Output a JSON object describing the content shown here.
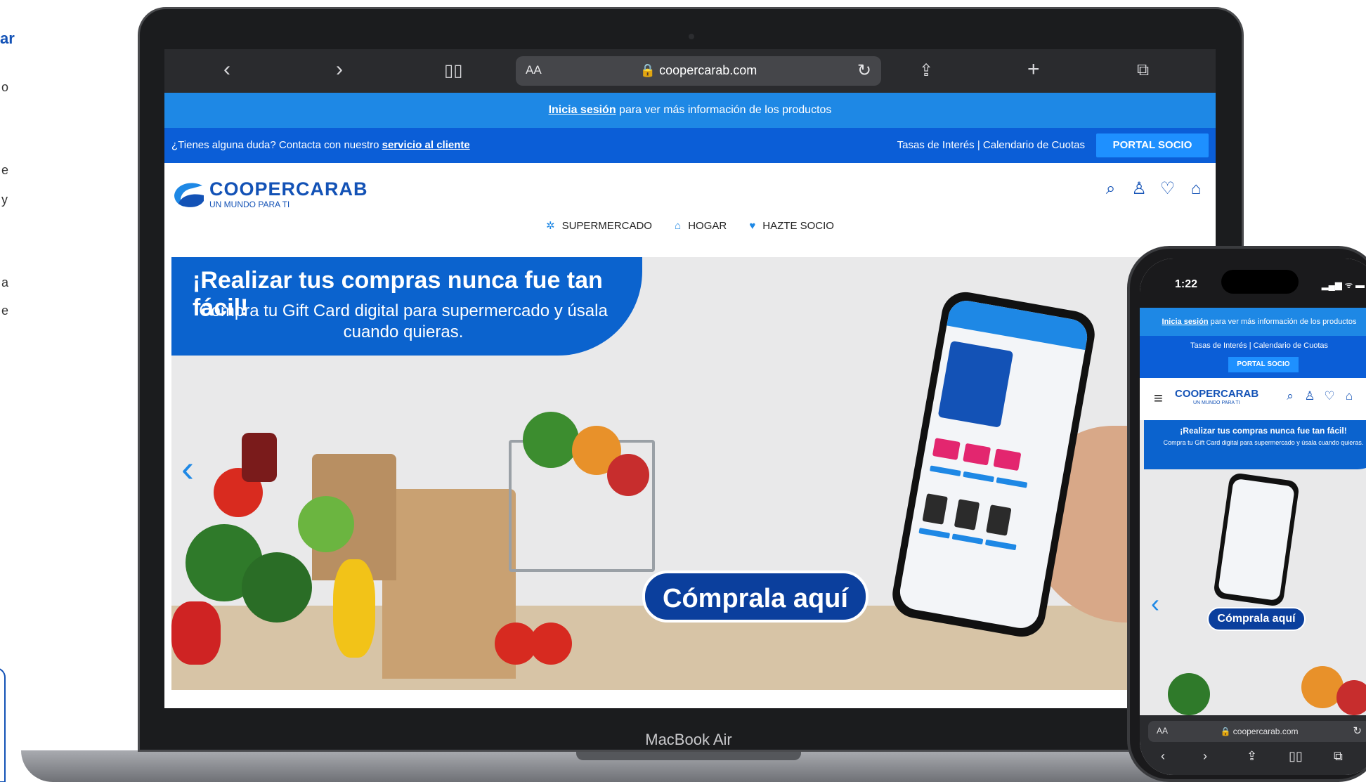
{
  "left_fragment": {
    "heading": "ar",
    "letters": [
      "o",
      "e",
      "y",
      "a",
      "e"
    ]
  },
  "browser": {
    "back_icon": "chevron-left-icon",
    "forward_icon": "chevron-right-icon",
    "aa_label": "AA",
    "url": "🔒 coopercarab.com",
    "reload_glyph": "↻"
  },
  "site": {
    "promo": {
      "link": "Inicia sesión",
      "text": " para ver más información de los productos"
    },
    "help": {
      "text": "¿Tienes alguna duda? Contacta con nuestro ",
      "link": "servicio al cliente",
      "right": "Tasas de Interés | Calendario de Cuotas",
      "portal": "PORTAL SOCIO"
    },
    "logo": {
      "name": "COOPERCARAB",
      "tagline": "UN MUNDO PARA TI"
    },
    "nav": [
      {
        "label": "SUPERMERCADO",
        "icon": "✲"
      },
      {
        "label": "HOGAR",
        "icon": "⌂"
      },
      {
        "label": "HAZTE SOCIO",
        "icon": "♥"
      }
    ],
    "hero": {
      "title": "¡Realizar tus compras nunca fue tan fácil!",
      "subtitle": "Compra tu Gift Card digital para supermercado y úsala cuando quieras.",
      "cta": "Cómprala aquí"
    }
  },
  "laptop_label": "MacBook Air",
  "phone": {
    "time": "1:22",
    "signal": "▂▄▆ ᯤ ▬",
    "promo_link": "Inicia sesión",
    "promo_text": " para ver más información de los productos",
    "help_right": "Tasas de Interés | Calendario de Cuotas",
    "portal": "PORTAL SOCIO",
    "logo_name": "COOPERCARAB",
    "logo_tag": "UN MUNDO PARA TI",
    "hero_title": "¡Realizar tus compras nunca fue tan fácil!",
    "hero_sub": "Compra tu Gift Card digital para supermercado y úsala cuando quieras.",
    "cta": "Cómprala aquí",
    "aa": "AA",
    "url": "🔒 coopercarab.com"
  },
  "colors": {
    "brand_blue": "#1352b6",
    "light_blue": "#1e88e5",
    "dark_blue": "#0b3f9d"
  }
}
